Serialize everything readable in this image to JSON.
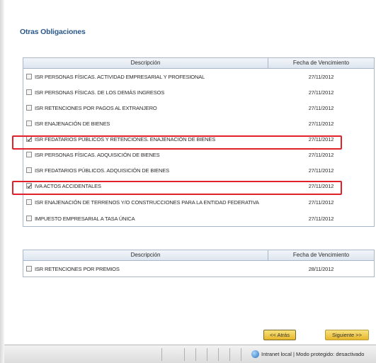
{
  "section_title": "Otras Obligaciones",
  "table1": {
    "headers": {
      "description": "Descripción",
      "due_date": "Fecha de Vencimiento"
    },
    "rows": [
      {
        "label": "ISR PERSONAS FÍSICAS. ACTIVIDAD EMPRESARIAL Y PROFESIONAL",
        "date": "27/11/2012",
        "checked": false
      },
      {
        "label": "ISR PERSONAS FÍSICAS. DE LOS DEMÁS INGRESOS",
        "date": "27/11/2012",
        "checked": false
      },
      {
        "label": "ISR RETENCIONES POR PAGOS AL EXTRANJERO",
        "date": "27/11/2012",
        "checked": false
      },
      {
        "label": "ISR ENAJENACIÓN DE BIENES",
        "date": "27/11/2012",
        "checked": false
      },
      {
        "label": "ISR FEDATARIOS PÚBLICOS Y RETENCIONES. ENAJENACIÓN DE BIENES",
        "date": "27/11/2012",
        "checked": true
      },
      {
        "label": "ISR PERSONAS FÍSICAS. ADQUISICIÓN DE BIENES",
        "date": "27/11/2012",
        "checked": false
      },
      {
        "label": "ISR FEDATARIOS PÚBLICOS. ADQUISICIÓN DE BIENES",
        "date": "27/11/2012",
        "checked": false
      },
      {
        "label": "IVA ACTOS ACCIDENTALES",
        "date": "27/11/2012",
        "checked": true
      },
      {
        "label": "ISR ENAJENACIÓN DE TERRENOS Y/O CONSTRUCCIONES PARA LA ENTIDAD FEDERATIVA",
        "date": "27/11/2012",
        "checked": false
      },
      {
        "label": "IMPUESTO EMPRESARIAL A TASA ÚNICA",
        "date": "27/11/2012",
        "checked": false
      }
    ]
  },
  "table2": {
    "headers": {
      "description": "Descripción",
      "due_date": "Fecha de Vencimiento"
    },
    "rows": [
      {
        "label": "ISR RETENCIONES POR PREMIOS",
        "date": "28/11/2012",
        "checked": false
      }
    ]
  },
  "buttons": {
    "prev": "<< Atrás",
    "next": "Siguiente >>"
  },
  "statusbar": {
    "zone_text": "Intranet local | Modo protegido: desactivado"
  },
  "colors": {
    "highlight": "#e0202a",
    "title": "#2d5a8a",
    "button": "#e8b72b"
  }
}
